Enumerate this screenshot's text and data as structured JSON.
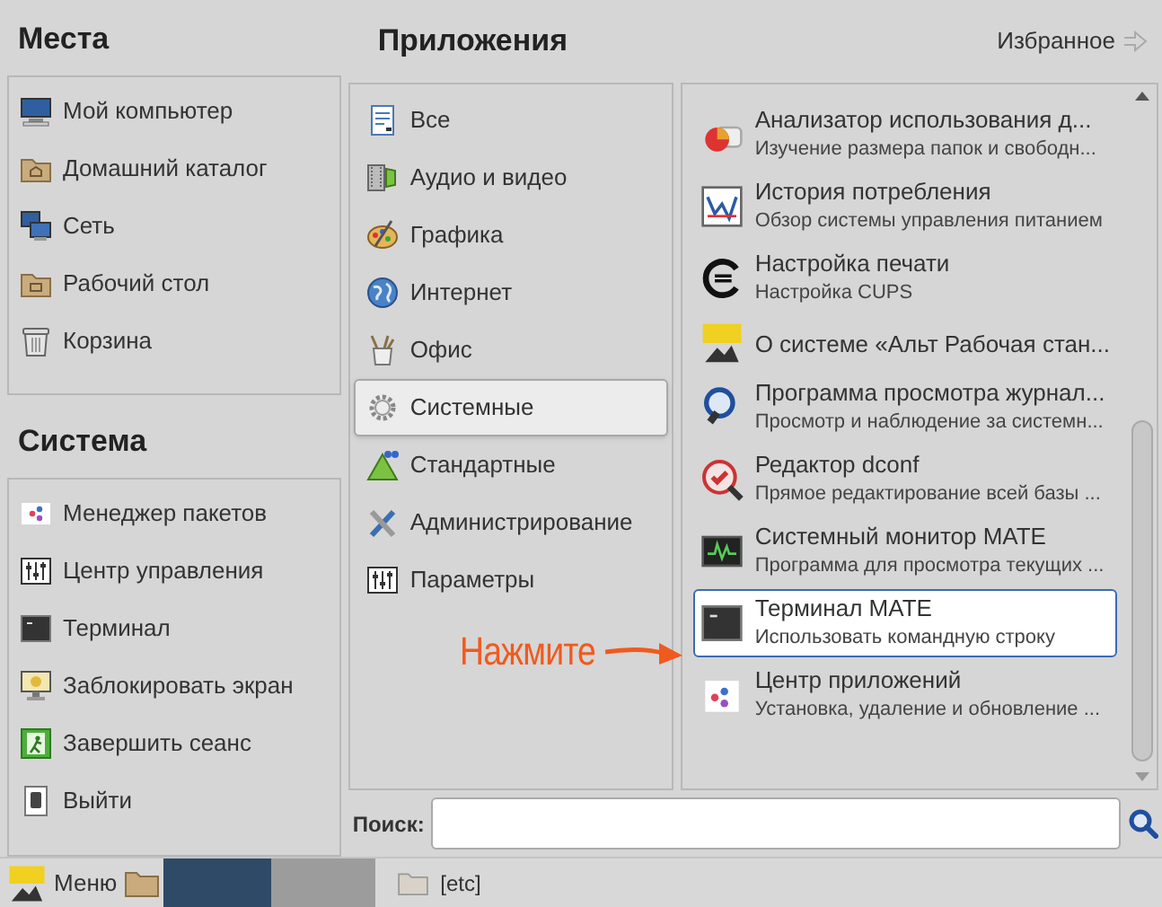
{
  "places": {
    "title": "Места",
    "items": [
      {
        "label": "Мой компьютер"
      },
      {
        "label": "Домашний каталог"
      },
      {
        "label": "Сеть"
      },
      {
        "label": "Рабочий стол"
      },
      {
        "label": "Корзина"
      }
    ]
  },
  "system": {
    "title": "Система",
    "items": [
      {
        "label": "Менеджер пакетов"
      },
      {
        "label": "Центр управления"
      },
      {
        "label": "Терминал"
      },
      {
        "label": "Заблокировать экран"
      },
      {
        "label": "Завершить сеанс"
      },
      {
        "label": "Выйти"
      }
    ]
  },
  "applications": {
    "title": "Приложения",
    "favorites_label": "Избранное",
    "categories": [
      {
        "label": "Все",
        "selected": false
      },
      {
        "label": "Аудио и видео",
        "selected": false
      },
      {
        "label": "Графика",
        "selected": false
      },
      {
        "label": "Интернет",
        "selected": false
      },
      {
        "label": "Офис",
        "selected": false
      },
      {
        "label": "Системные",
        "selected": true
      },
      {
        "label": "Стандартные",
        "selected": false
      },
      {
        "label": "Администрирование",
        "selected": false
      },
      {
        "label": "Параметры",
        "selected": false
      }
    ],
    "items": [
      {
        "title": "Анализатор использования д...",
        "description": "Изучение размера папок и свободн...",
        "selected": false
      },
      {
        "title": "История потребления",
        "description": "Обзор системы управления питанием",
        "selected": false
      },
      {
        "title": "Настройка печати",
        "description": "Настройка CUPS",
        "selected": false
      },
      {
        "title": "О системе «Альт Рабочая стан...",
        "selected": false
      },
      {
        "title": "Программа просмотра журнал...",
        "description": "Просмотр и наблюдение за системн...",
        "selected": false
      },
      {
        "title": "Редактор dconf",
        "description": "Прямое редактирование всей базы ...",
        "selected": false
      },
      {
        "title": "Системный монитор MATE",
        "description": "Программа для просмотра текущих ...",
        "selected": false
      },
      {
        "title": "Терминал MATE",
        "description": "Использовать командную строку",
        "selected": true
      },
      {
        "title": "Центр приложений",
        "description": "Установка, удаление и обновление ...",
        "selected": false
      }
    ]
  },
  "search": {
    "label": "Поиск:"
  },
  "annotation": {
    "text": "Нажмите"
  },
  "taskbar": {
    "menu_label": "Меню",
    "window_label": "[etc]"
  }
}
